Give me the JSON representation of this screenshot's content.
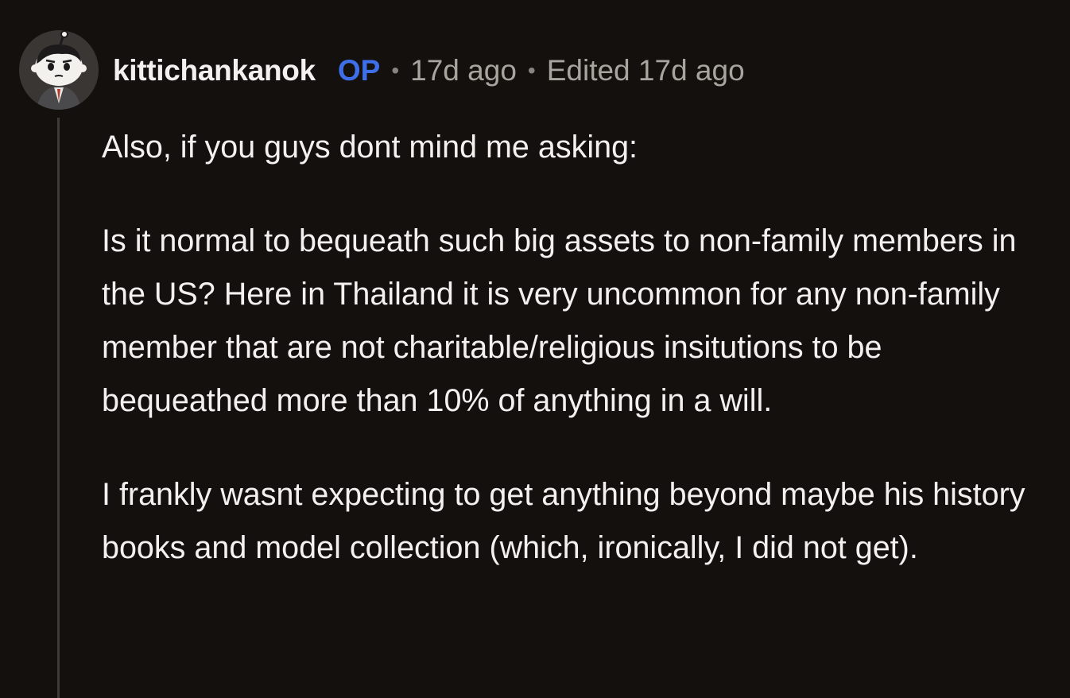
{
  "comment": {
    "username": "kittichankanok",
    "op_badge": "OP",
    "separator": "•",
    "time_ago": "17d ago",
    "edited": "Edited 17d ago",
    "avatar_icon": "snoo-avatar-icon",
    "paragraphs": [
      "Also, if you guys dont mind me asking:",
      "Is it normal to bequeath such big assets to non-family members in the US? Here in Thailand it is very uncommon for any non-family member that are not charitable/religious insitutions to be bequeathed more than 10% of anything in a will.",
      "I frankly wasnt expecting to get anything beyond maybe his history books and model collection (which, ironically, I did not get)."
    ]
  },
  "colors": {
    "background": "#13100e",
    "text": "#f2f1ef",
    "op_accent": "#3e6ee8",
    "meta": "#aaa49e",
    "thread_line": "#3f3b38"
  }
}
